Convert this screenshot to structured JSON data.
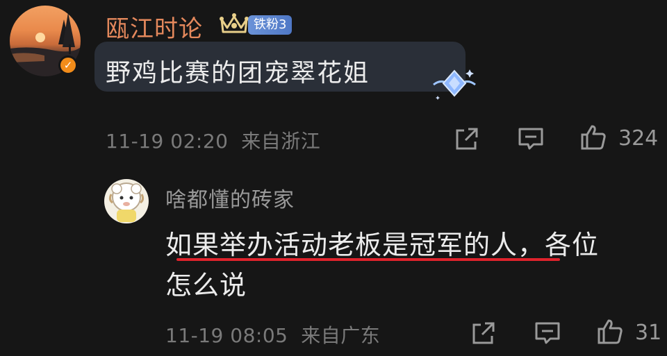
{
  "main_comment": {
    "username": "瓯江时论",
    "fan_badge": "铁粉3",
    "text": "野鸡比赛的团宠翠花姐",
    "time": "11-19 02:20",
    "location": "来自浙江",
    "like_count": "324",
    "icons": [
      "share-icon",
      "comment-icon",
      "like-icon",
      "crown-icon",
      "verified-icon"
    ]
  },
  "reply": {
    "username": "啥都懂的砖家",
    "text_line1": "如果举办活动老板是冠军的人，各位",
    "text_line2": "怎么说",
    "time": "11-19 08:05",
    "location": "来自广东",
    "like_count": "31",
    "icons": [
      "share-icon",
      "comment-icon",
      "like-icon"
    ]
  },
  "colors": {
    "background": "#161616",
    "username_main": "#e4885c",
    "badge": "#5a83cf",
    "underline": "#e0232c",
    "verified": "#f28c1a"
  }
}
